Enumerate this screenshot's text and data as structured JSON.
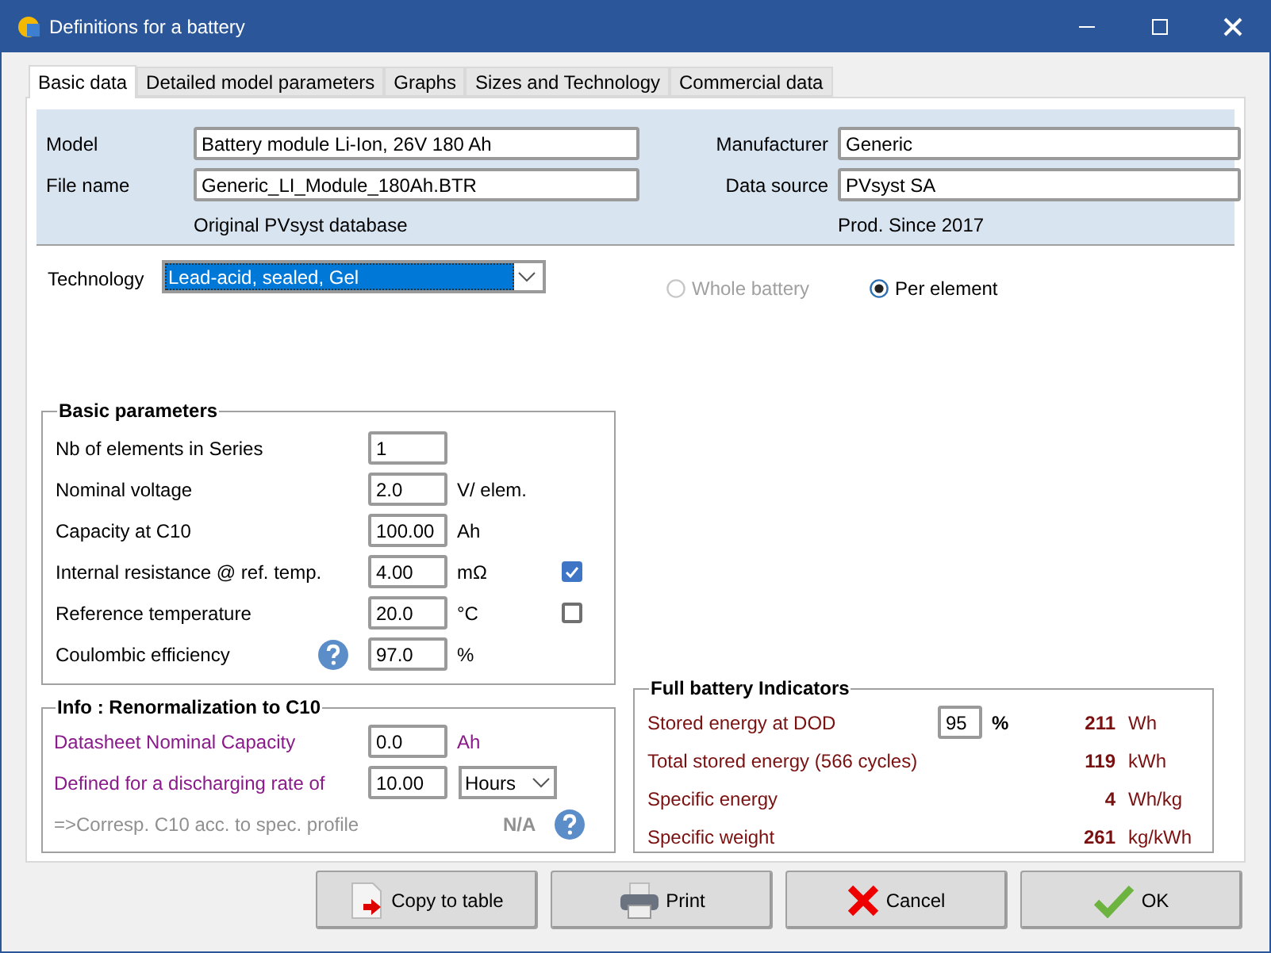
{
  "window": {
    "title": "Definitions for a battery"
  },
  "tabs": [
    {
      "label": "Basic data",
      "selected": true
    },
    {
      "label": "Detailed model parameters",
      "selected": false
    },
    {
      "label": "Graphs",
      "selected": false
    },
    {
      "label": "Sizes and Technology",
      "selected": false
    },
    {
      "label": "Commercial data",
      "selected": false
    }
  ],
  "identity": {
    "left": [
      {
        "label": "Model",
        "value": "Battery module Li-Ion, 26V 180 Ah"
      },
      {
        "label": "File name",
        "value": "Generic_LI_Module_180Ah.BTR"
      }
    ],
    "left_note": "Original PVsyst database",
    "right": [
      {
        "label": "Manufacturer",
        "value": "Generic"
      },
      {
        "label": "Data source",
        "value": "PVsyst SA"
      }
    ],
    "right_note": "Prod. Since 2017"
  },
  "technology": {
    "label": "Technology",
    "value": "Lead-acid, sealed, Gel"
  },
  "scope_options": [
    {
      "label": "Whole battery",
      "selected": false,
      "disabled": true
    },
    {
      "label": "Per element",
      "selected": true,
      "disabled": false
    }
  ],
  "basic_parameters": {
    "title": "Basic parameters",
    "rows": [
      {
        "label": "Nb of elements in Series",
        "value": "1"
      },
      {
        "label": "Nominal voltage",
        "value": "2.0",
        "unit": "V/ elem."
      },
      {
        "label": "Capacity at C10",
        "value": "100.00",
        "unit": "Ah"
      },
      {
        "label": "Internal resistance @ ref. temp.",
        "value": "4.00",
        "unit": "mΩ",
        "checked": true
      },
      {
        "label": "Reference temperature",
        "value": "20.0",
        "unit": "°C",
        "checked": false
      },
      {
        "label": "Coulombic efficiency",
        "value": "97.0",
        "unit": "%",
        "help": true
      }
    ]
  },
  "renormalization": {
    "title": "Info : Renormalization to C10",
    "rows": [
      {
        "kind": "input",
        "label": "Datasheet Nominal Capacity",
        "value": "0.0",
        "unit": "Ah"
      },
      {
        "kind": "select",
        "label": "Defined for a discharging rate of",
        "value": "10.00",
        "option": "Hours"
      },
      {
        "kind": "result",
        "label": "=>Corresp. C10 acc. to spec. profile",
        "result": "N/A",
        "help": true
      }
    ]
  },
  "indicators": {
    "title": "Full battery Indicators",
    "rows": [
      {
        "label": "Stored energy at DOD",
        "input": "95",
        "input_unit": "%",
        "value": "211",
        "unit": "Wh"
      },
      {
        "label": "Total stored energy (566 cycles)",
        "value": "119",
        "unit": "kWh"
      },
      {
        "label": "Specific energy",
        "value": "4",
        "unit": "Wh/kg"
      },
      {
        "label": "Specific weight",
        "value": "261",
        "unit": "kg/kWh"
      }
    ]
  },
  "buttons": [
    {
      "kind": "copy",
      "label": "Copy to table"
    },
    {
      "kind": "print",
      "label": "Print"
    },
    {
      "kind": "cancel",
      "label": "Cancel"
    },
    {
      "kind": "ok",
      "label": "OK"
    }
  ]
}
